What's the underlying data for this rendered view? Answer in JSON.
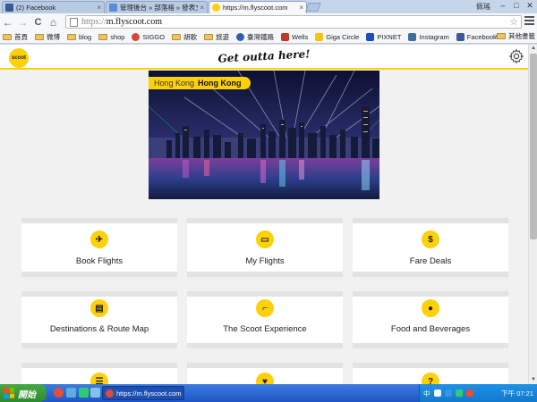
{
  "colors": {
    "brand_yellow": "#fdd10a",
    "page_bg": "#f1f1f1",
    "card_divider": "#e3e3e3"
  },
  "browser": {
    "tabs": [
      {
        "label": "(2) Facebook",
        "icon": "facebook-icon",
        "active": false
      },
      {
        "label": "管理後台 » 部落格 » 發表文章",
        "icon": "blogger-icon",
        "active": false
      },
      {
        "label": "https://m.flyscoot.com",
        "icon": "scoot-icon",
        "active": true
      }
    ],
    "tab_close": "×",
    "window_user": "佩瑤",
    "window_controls": {
      "minimize": "‒",
      "maximize": "□",
      "close": "✕"
    },
    "toolbar": {
      "back": "←",
      "forward": "→",
      "reload": "C",
      "home": "⌂"
    },
    "address": {
      "protocol": "https://",
      "host": "m.flyscoot.com"
    },
    "bookmark_star": "☆",
    "bookmarks": [
      {
        "label": "首頁",
        "type": "folder"
      },
      {
        "label": "微博",
        "type": "folder"
      },
      {
        "label": "blog",
        "type": "folder"
      },
      {
        "label": "shop",
        "type": "folder"
      },
      {
        "label": "SIGGO",
        "type": "site",
        "color": "#d9453d"
      },
      {
        "label": "胡歌",
        "type": "folder"
      },
      {
        "label": "旅遊",
        "type": "folder"
      },
      {
        "label": "臺灣鐵路",
        "type": "site",
        "color": "#2f5fb3"
      },
      {
        "label": "Wells",
        "type": "site",
        "color": "#c0392b"
      },
      {
        "label": "Giga Circle",
        "type": "site",
        "color": "#f1c40f"
      },
      {
        "label": "PIXNET",
        "type": "site",
        "color": "#1a4fbf"
      },
      {
        "label": "Instagram",
        "type": "site",
        "color": "#3f729b"
      },
      {
        "label": "Facebook",
        "type": "site",
        "color": "#3b5998"
      }
    ],
    "bookmarks_more": "»",
    "bookmarks_other": "其他書籤"
  },
  "site": {
    "logo_text": "scoot",
    "tagline": "Get outta here!",
    "settings_icon": "gear-icon",
    "hero": {
      "city_zh": "Hong Kong",
      "city_en": "Hong Kong"
    },
    "menu": [
      {
        "label": "Book Flights",
        "icon": "plane-icon",
        "glyph": "✈"
      },
      {
        "label": "My Flights",
        "icon": "ticket-icon",
        "glyph": "▭"
      },
      {
        "label": "Fare Deals",
        "icon": "dollar-icon",
        "glyph": "$"
      },
      {
        "label": "Destinations & Route Map",
        "icon": "map-icon",
        "glyph": "▤"
      },
      {
        "label": "The Scoot Experience",
        "icon": "seat-icon",
        "glyph": "⌐"
      },
      {
        "label": "Food and Beverages",
        "icon": "food-icon",
        "glyph": "●"
      },
      {
        "label": "",
        "icon": "list-icon",
        "glyph": "☰"
      },
      {
        "label": "",
        "icon": "heart-icon",
        "glyph": "♥"
      },
      {
        "label": "",
        "icon": "help-icon",
        "glyph": "?"
      }
    ]
  },
  "taskbar": {
    "start_label": "開始",
    "task_label": "https://m.flyscoot.com ...",
    "tray_lang": "中",
    "clock": "下午 07:21"
  }
}
